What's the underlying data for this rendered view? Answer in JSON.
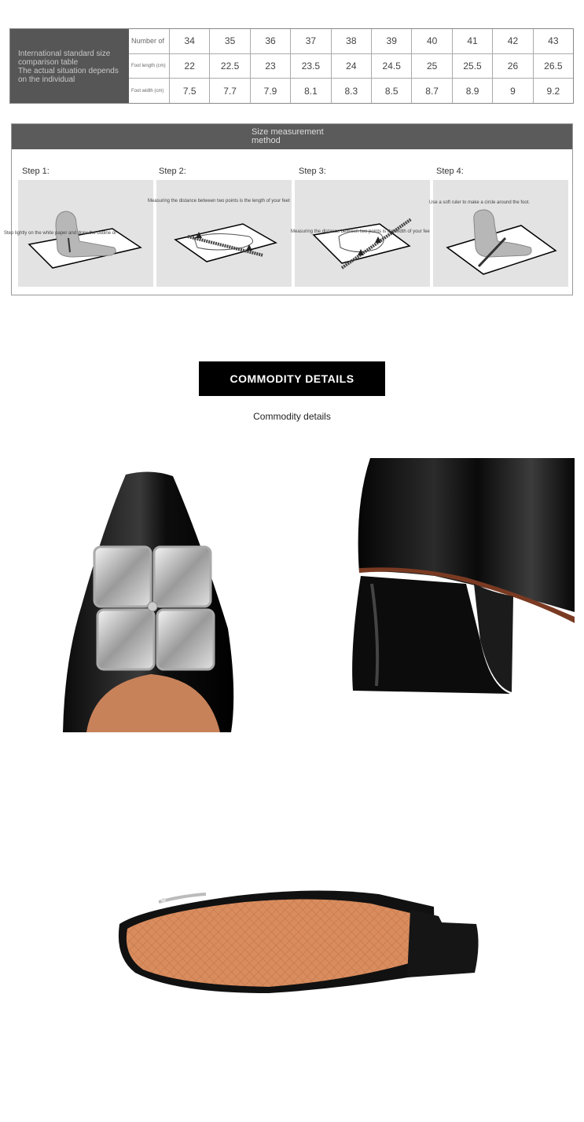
{
  "size_table": {
    "label_lines": [
      "International standard size",
      "comparison table",
      "The actual situation depends",
      "on the individual"
    ],
    "rows": [
      {
        "header": "Number of",
        "values": [
          "34",
          "35",
          "36",
          "37",
          "38",
          "39",
          "40",
          "41",
          "42",
          "43"
        ]
      },
      {
        "header": "Foot length (cm)",
        "values": [
          "22",
          "22.5",
          "23",
          "23.5",
          "24",
          "24.5",
          "25",
          "25.5",
          "26",
          "26.5"
        ]
      },
      {
        "header": "Foot width (cm)",
        "values": [
          "7.5",
          "7.7",
          "7.9",
          "8.1",
          "8.3",
          "8.5",
          "8.7",
          "8.9",
          "9",
          "9.2"
        ]
      }
    ]
  },
  "measurement": {
    "title_lines": [
      "Size measurement",
      "method"
    ],
    "steps": [
      {
        "label": "Step 1:",
        "caption": "Step lightly on the white paper and draw the outline of"
      },
      {
        "label": "Step 2:",
        "caption": "Measuring the distance between two points is the length of your feet"
      },
      {
        "label": "Step 3:",
        "caption": "Measuring the distance between two points is the width of your fee"
      },
      {
        "label": "Step 4:",
        "caption": "Use a soft ruler to make a circle around the foot."
      }
    ]
  },
  "commodity": {
    "banner": "COMMODITY DETAILS",
    "subtitle": "Commodity details"
  },
  "photo_icons": [
    "shoe-toe-crystal-photo",
    "shoe-heel-photo",
    "shoe-sole-photo"
  ]
}
